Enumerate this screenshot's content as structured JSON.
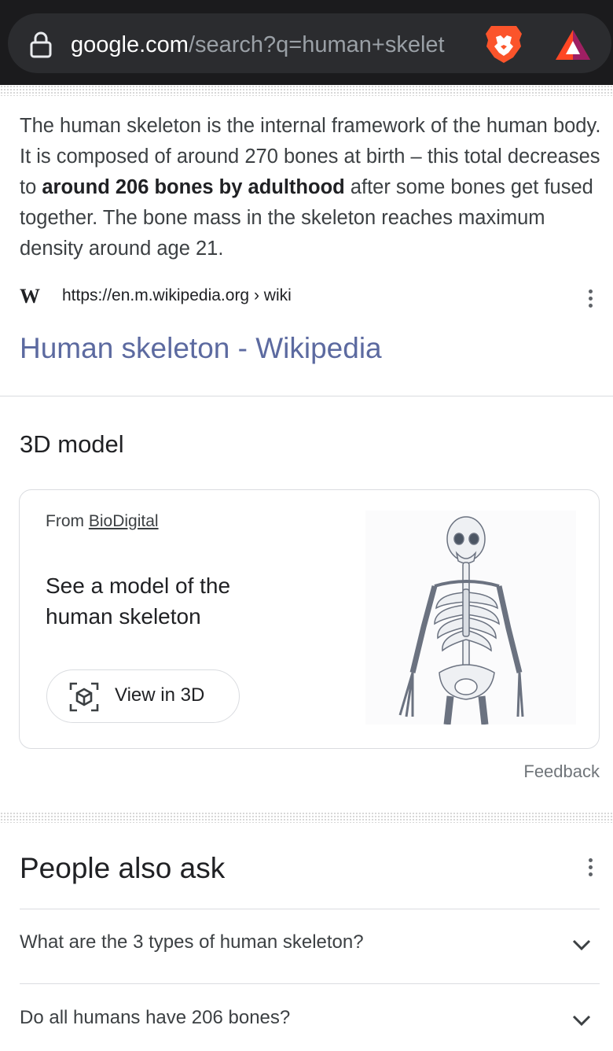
{
  "browser": {
    "url_domain": "google.com",
    "url_path": "/search?q=human+skelet",
    "icons": [
      "lock-icon",
      "brave-lion-icon",
      "bat-rewards-icon"
    ],
    "colors": {
      "bar": "#1b1b1d",
      "url_field": "#2b2c2f",
      "brave": "#fb542b"
    }
  },
  "snippet": {
    "text_before": "The human skeleton is the internal framework of the human body. It is composed of around 270 bones at birth – this total decreases to ",
    "bold": "around 206 bones by adulthood",
    "text_after": " after some bones get fused together. The bone mass in the skeleton reaches maximum density around age 21.",
    "source_icon": "W",
    "source_url": "https://en.m.wikipedia.org › wiki",
    "title": "Human skeleton - Wikipedia",
    "title_color": "#5c6aa0"
  },
  "model_section": {
    "title": "3D model",
    "from_label": "From",
    "from_link": "BioDigital",
    "heading": "See a model of the human skeleton",
    "button_label": "View in 3D",
    "button_icon": "cube-3d-icon",
    "image": "skeleton-image",
    "feedback": "Feedback"
  },
  "people_also_ask": {
    "title": "People also ask",
    "questions": [
      {
        "text": "What are the 3 types of human skeleton?"
      },
      {
        "text": "Do all humans have 206 bones?"
      }
    ]
  }
}
